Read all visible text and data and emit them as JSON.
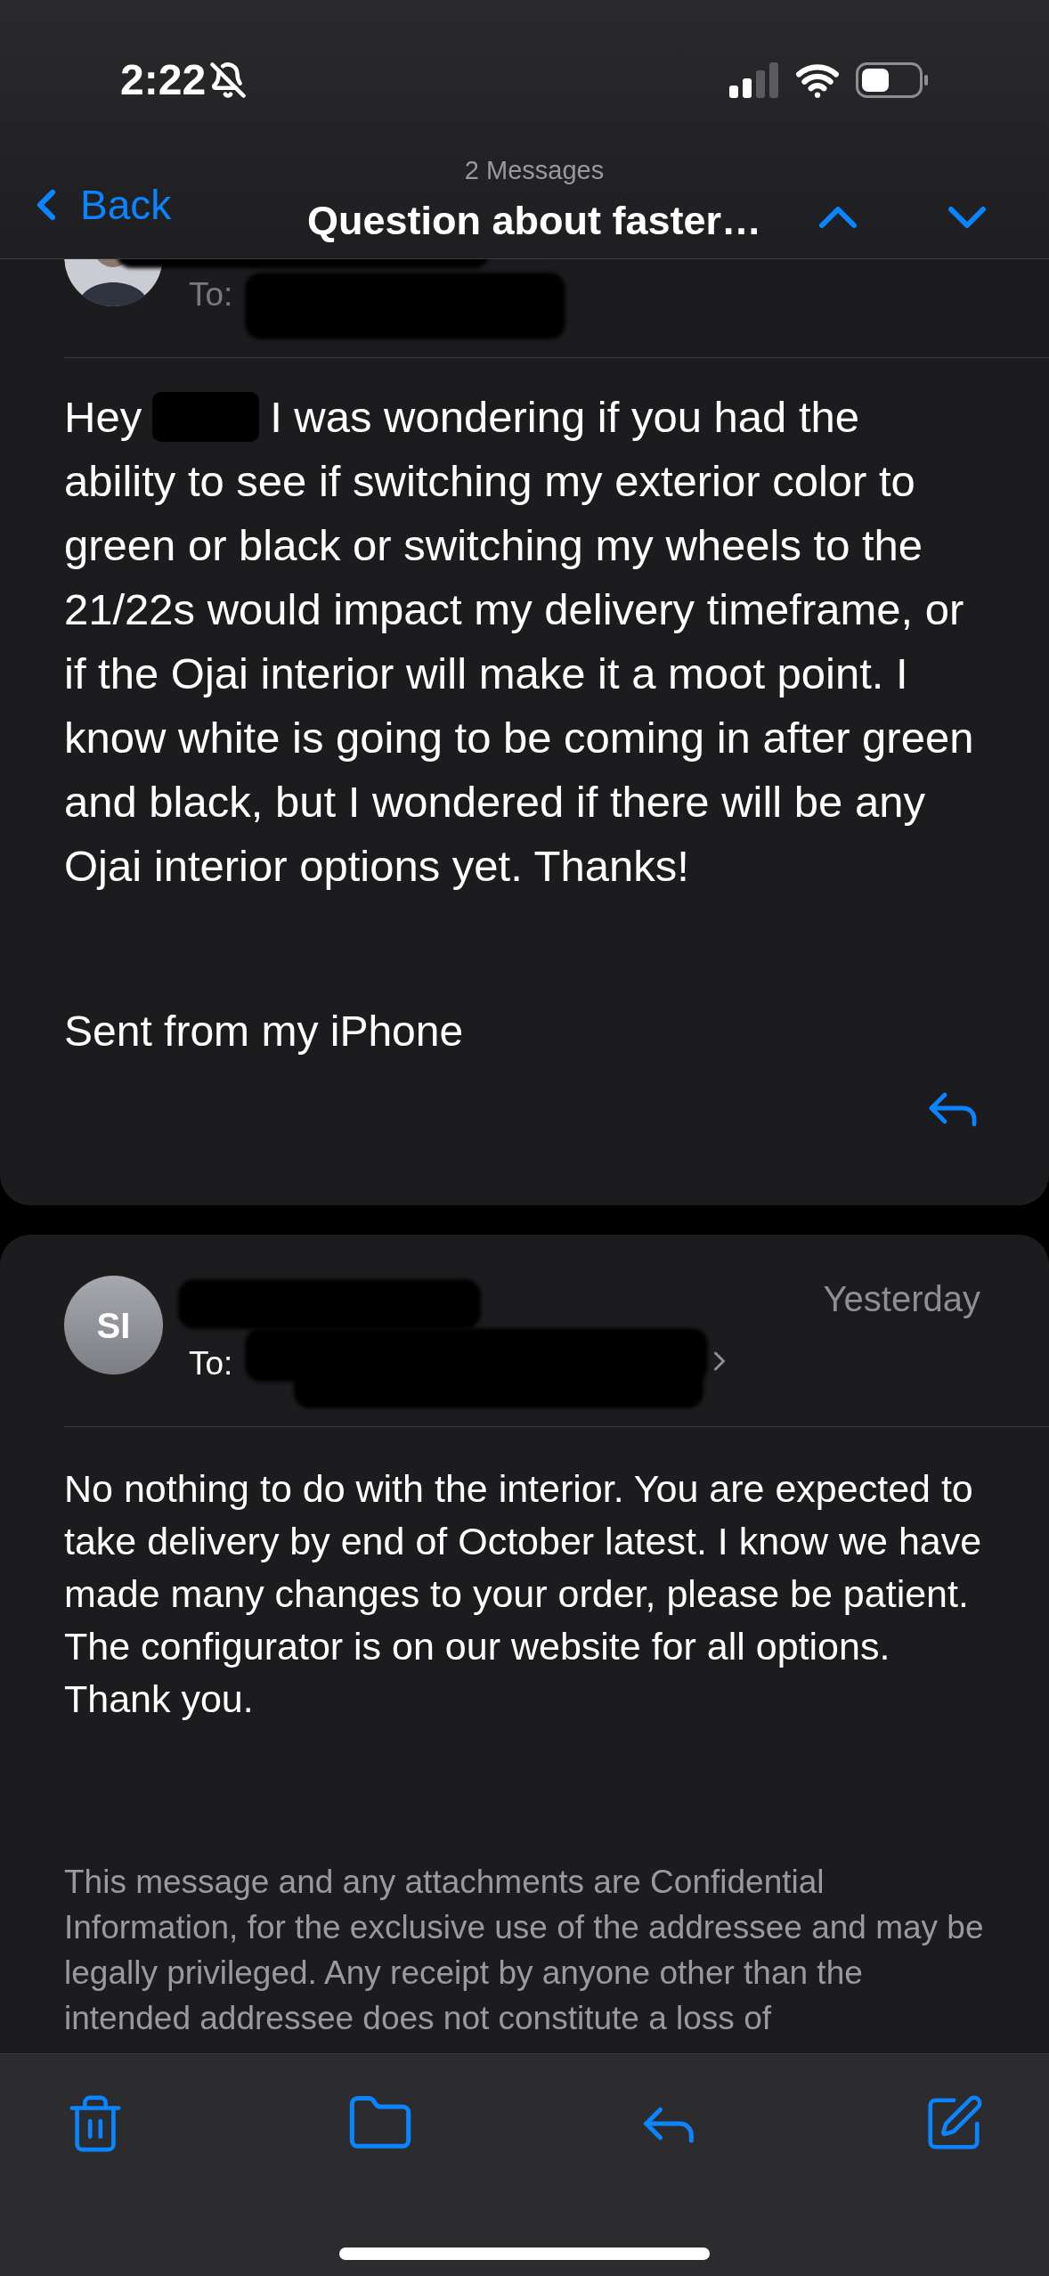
{
  "status_bar": {
    "time": "2:22"
  },
  "nav": {
    "back": "Back",
    "count": "2 Messages",
    "title": "Question about faster…"
  },
  "messages": [
    {
      "to_label": "To:",
      "greeting": "Hey",
      "body_lead": "I was wondering if you had the",
      "body": "ability to see if switching my exterior color to green or black or switching my wheels to the 21/22s would impact my delivery timeframe, or if the Ojai interior will make it a moot point. I know white is going to be coming in after green and black, but I wondered if there will be any Ojai interior options yet. Thanks!",
      "signature": "Sent from my iPhone"
    },
    {
      "kind": "initials",
      "initials": "SI",
      "date": "Yesterday",
      "to_label": "To:",
      "body": "No nothing to do with the interior. You are expected to take delivery by end of October latest. I know we have made many changes to your order, please be patient.\nThe configurator is on our website for all options. Thank you.",
      "disclaimer": "This message and any attachments are Confidential Information, for the exclusive use of the addressee and may be legally privileged. Any receipt by anyone other than the intended addressee does not constitute a loss of"
    }
  ]
}
